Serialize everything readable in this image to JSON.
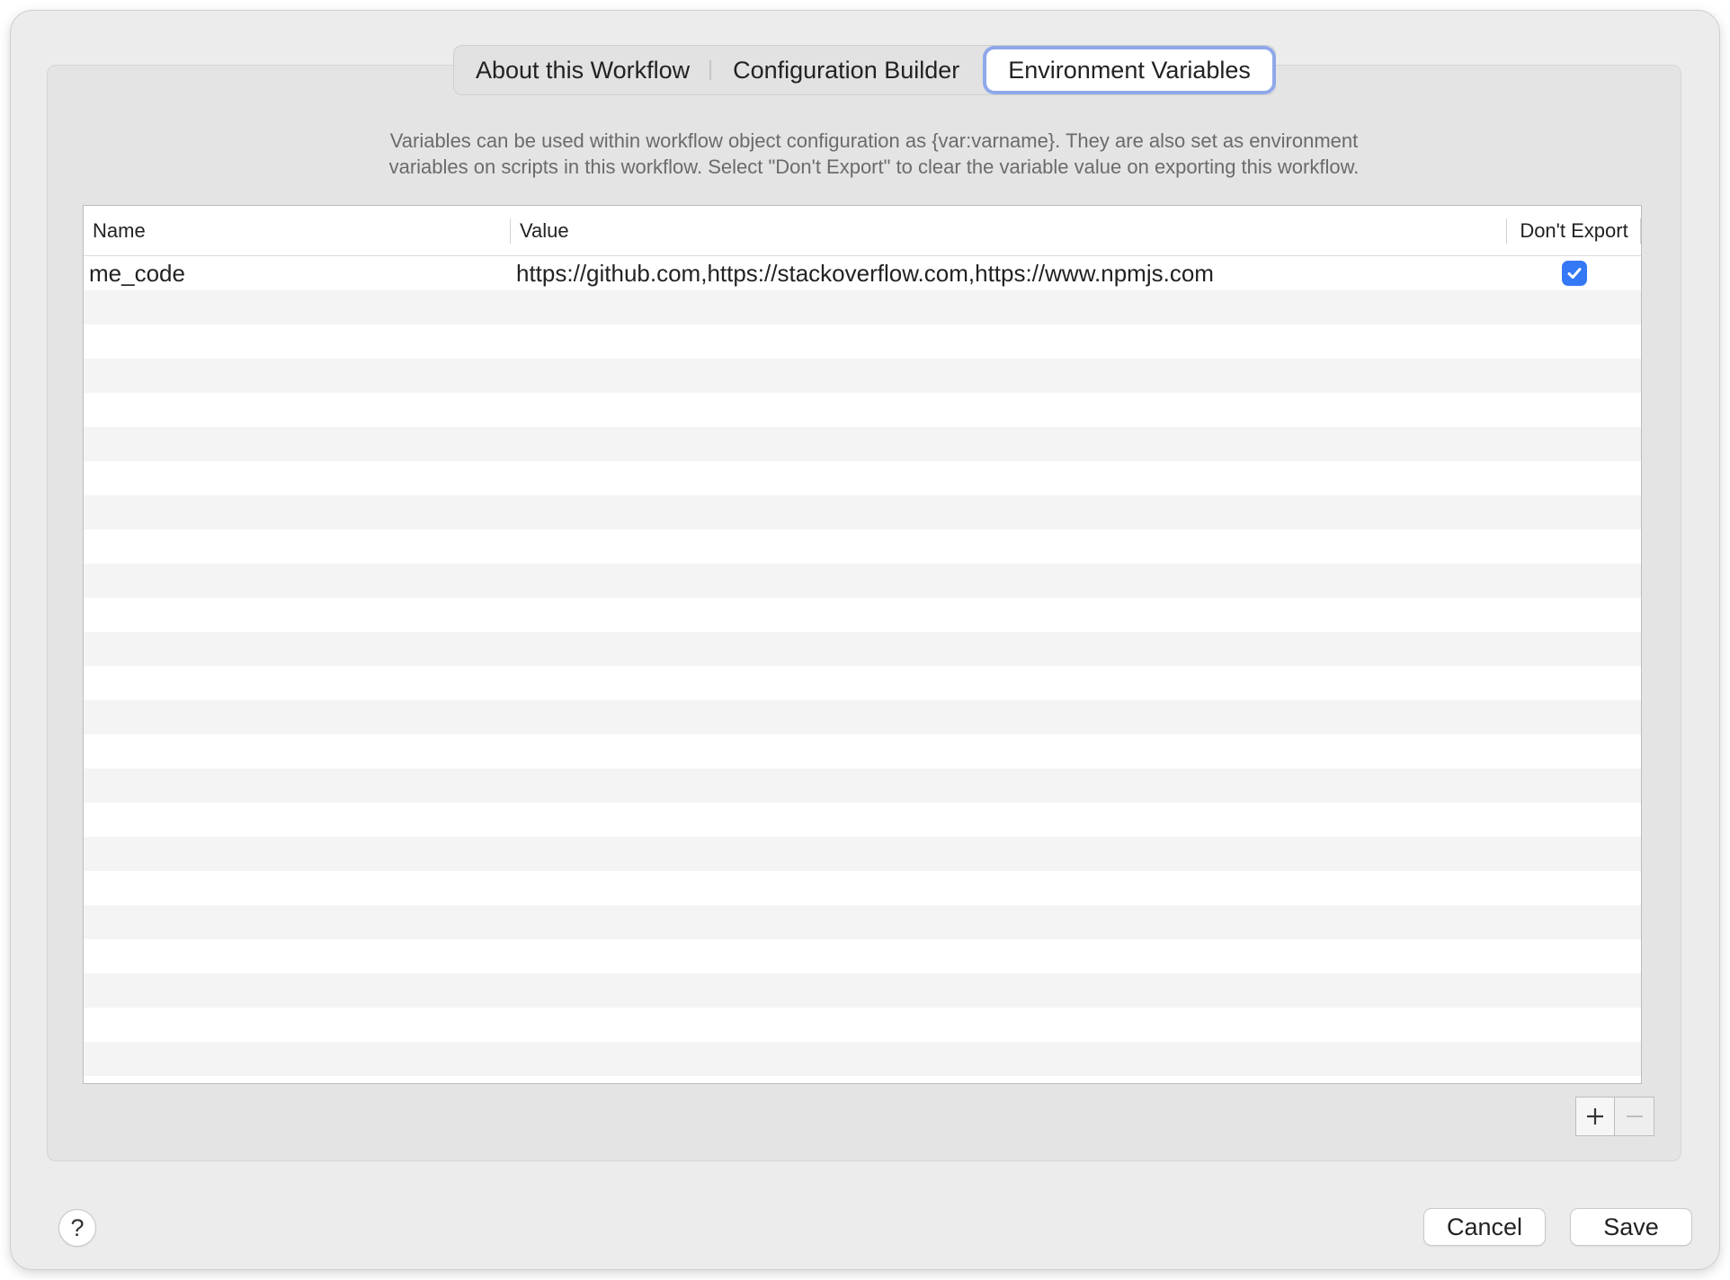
{
  "tabs": [
    {
      "label": "About this Workflow",
      "active": false
    },
    {
      "label": "Configuration Builder",
      "active": false
    },
    {
      "label": "Environment Variables",
      "active": true
    }
  ],
  "description": {
    "line1": "Variables can be used within workflow object configuration as {var:varname}. They are also set as environment",
    "line2": "variables on scripts in this workflow. Select \"Don't Export\" to clear the variable value on exporting this workflow."
  },
  "table": {
    "columns": {
      "name": "Name",
      "value": "Value",
      "dont_export": "Don't Export"
    },
    "rows": [
      {
        "name": "me_code",
        "value": "https://github.com,https://stackoverflow.com,https://www.npmjs.com",
        "dont_export": true
      }
    ]
  },
  "controls": {
    "add_icon": "plus-icon",
    "remove_icon": "minus-icon",
    "remove_enabled": false
  },
  "footer": {
    "help_label": "?",
    "cancel_label": "Cancel",
    "save_label": "Save"
  },
  "colors": {
    "accent": "#3478f6",
    "tab_focus_ring": "#8ea8ea",
    "window_bg": "#ececec"
  }
}
